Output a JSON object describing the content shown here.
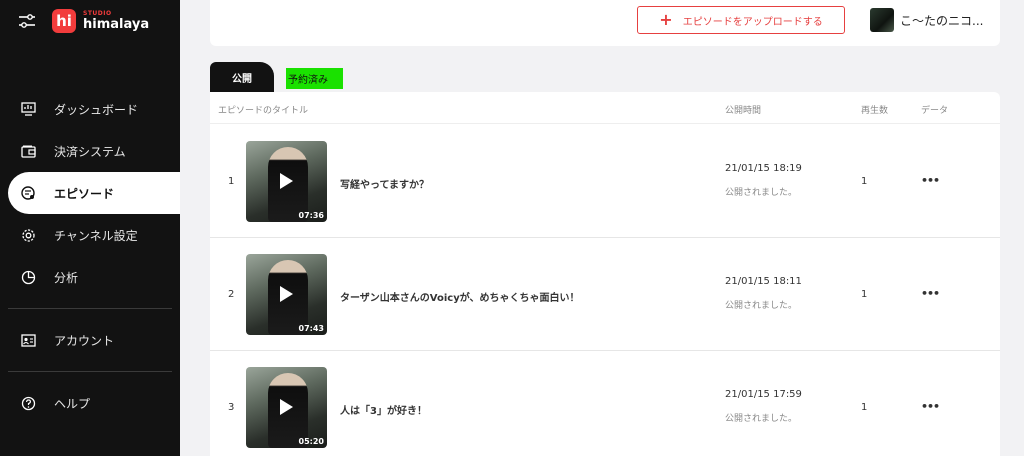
{
  "sidebar": {
    "logo_badge": "hi",
    "logo_studio": "STUDIO",
    "logo_name": "himalaya",
    "items": [
      {
        "label": "ダッシュボード",
        "icon": "dashboard-icon"
      },
      {
        "label": "決済システム",
        "icon": "wallet-icon"
      },
      {
        "label": "エピソード",
        "icon": "episode-icon",
        "active": true
      },
      {
        "label": "チャンネル設定",
        "icon": "gear-icon"
      },
      {
        "label": "分析",
        "icon": "pie-chart-icon"
      },
      {
        "label": "アカウント",
        "icon": "id-card-icon"
      },
      {
        "label": "ヘルプ",
        "icon": "help-icon"
      }
    ]
  },
  "header": {
    "upload_label": "エピソードをアップロードする",
    "upload_plus": "+",
    "user_name": "こ〜たのニコ..."
  },
  "tabs": {
    "public": "公開",
    "reserved": "予約済み"
  },
  "table": {
    "columns": {
      "title": "エピソードのタイトル",
      "published": "公開時間",
      "plays": "再生数",
      "data": "データ"
    },
    "rows": [
      {
        "num": "1",
        "title": "写経やってますか？",
        "date": "21/01/15 18:19",
        "status": "公開されました。",
        "plays": "1",
        "duration": "07:36",
        "more": "•••"
      },
      {
        "num": "2",
        "title": "ターザン山本さんのVoicyが、めちゃくちゃ面白い！",
        "date": "21/01/15 18:11",
        "status": "公開されました。",
        "plays": "1",
        "duration": "07:43",
        "more": "•••"
      },
      {
        "num": "3",
        "title": "人は「3」が好き！",
        "date": "21/01/15 17:59",
        "status": "公開されました。",
        "plays": "1",
        "duration": "05:20",
        "more": "•••"
      }
    ]
  },
  "colors": {
    "sidebar_bg": "#121212",
    "accent_red": "#e64040",
    "reserved_tab": "#1ae100"
  }
}
